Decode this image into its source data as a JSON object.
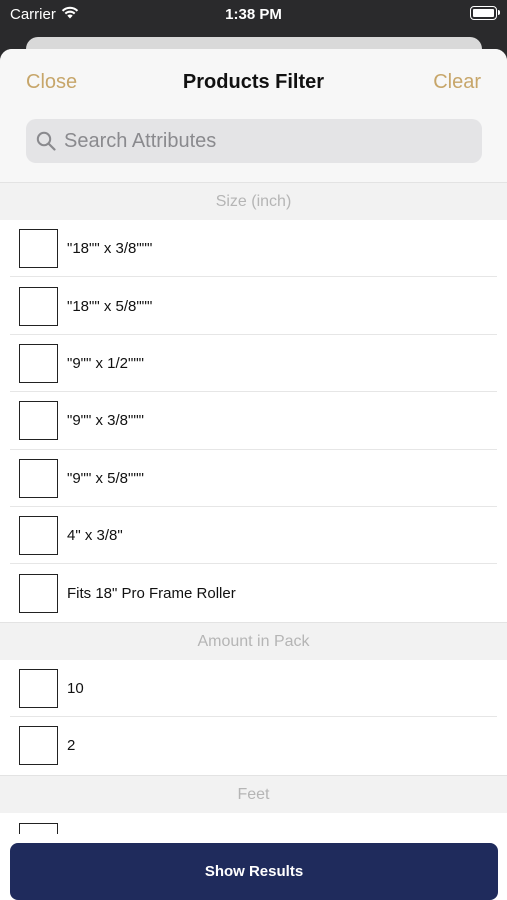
{
  "status_bar": {
    "carrier": "Carrier",
    "time": "1:38 PM"
  },
  "header": {
    "close_label": "Close",
    "title": "Products Filter",
    "clear_label": "Clear"
  },
  "search": {
    "placeholder": "Search Attributes",
    "value": ""
  },
  "sections": [
    {
      "title": "Size (inch)",
      "items": [
        {
          "label": "\"18\"\" x 3/8\"\"\"",
          "checked": false
        },
        {
          "label": "\"18\"\" x 5/8\"\"\"",
          "checked": false
        },
        {
          "label": "\"9\"\" x 1/2\"\"\"",
          "checked": false
        },
        {
          "label": "\"9\"\" x 3/8\"\"\"",
          "checked": false
        },
        {
          "label": "\"9\"\" x 5/8\"\"\"",
          "checked": false
        },
        {
          "label": "4\" x 3/8\"",
          "checked": false
        },
        {
          "label": "Fits 18\" Pro Frame Roller",
          "checked": false
        }
      ]
    },
    {
      "title": "Amount in Pack",
      "items": [
        {
          "label": "10",
          "checked": false
        },
        {
          "label": "2",
          "checked": false
        }
      ]
    },
    {
      "title": "Feet",
      "items": [
        {
          "label": "",
          "checked": false
        }
      ]
    }
  ],
  "footer": {
    "show_results_label": "Show Results"
  },
  "colors": {
    "accent": "#c7a66a",
    "primary_button": "#1f2b5c"
  }
}
